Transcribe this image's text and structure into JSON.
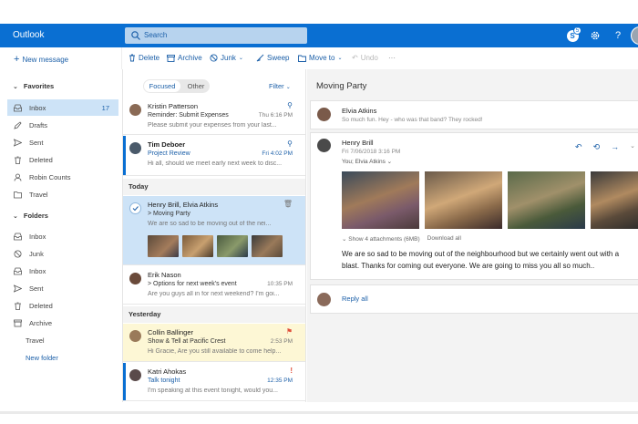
{
  "header": {
    "brand": "Outlook",
    "search_placeholder": "Search",
    "skype_badge": "5"
  },
  "toolbar": {
    "new_message": "New message",
    "delete": "Delete",
    "archive": "Archive",
    "junk": "Junk",
    "sweep": "Sweep",
    "move_to": "Move to",
    "undo": "Undo",
    "more": "···"
  },
  "nav": {
    "favorites_label": "Favorites",
    "favorites": [
      {
        "label": "Inbox",
        "count": "17"
      },
      {
        "label": "Drafts"
      },
      {
        "label": "Sent"
      },
      {
        "label": "Deleted"
      },
      {
        "label": "Robin Counts"
      },
      {
        "label": "Travel"
      }
    ],
    "folders_label": "Folders",
    "folders": [
      {
        "label": "Inbox"
      },
      {
        "label": "Junk"
      },
      {
        "label": "Inbox"
      },
      {
        "label": "Sent"
      },
      {
        "label": "Deleted"
      },
      {
        "label": "Archive"
      },
      {
        "label": "Travel"
      }
    ],
    "new_folder": "New folder"
  },
  "list": {
    "tab_focused": "Focused",
    "tab_other": "Other",
    "filter": "Filter",
    "section_today": "Today",
    "section_yesterday": "Yesterday",
    "messages": [
      {
        "from": "Kristin Patterson",
        "subject": "Reminder: Submit Expenses",
        "preview": "Please submit your expenses from your last...",
        "time": "Thu 6:16 PM"
      },
      {
        "from": "Tim Deboer",
        "subject": "Project Review",
        "preview": "Hi all, should we meet early next week to disc...",
        "time": "Fri 4:02 PM"
      },
      {
        "from": "Henry Brill, Elvia Atkins",
        "subject": "> Moving Party",
        "preview": "We are so sad to be moving out of the nei...",
        "time": ""
      },
      {
        "from": "Erik Nason",
        "subject": "> Options for next week's event",
        "preview": "Are you guys all in for next weekend? I'm goi...",
        "time": "10:35 PM"
      },
      {
        "from": "Collin Ballinger",
        "subject": "Show & Tell at Pacific Crest",
        "preview": "Hi Gracie, Are you still available to come help...",
        "time": "2:53 PM"
      },
      {
        "from": "Katri Ahokas",
        "subject": "Talk tonight",
        "preview": "I'm speaking at this event tonight, would you...",
        "time": "12:35 PM"
      }
    ]
  },
  "reading": {
    "title": "Moving Party",
    "first": {
      "from": "Elvia Atkins",
      "snippet": "So much fun. Hey - who was that band? They rocked!"
    },
    "second": {
      "from": "Henry Brill",
      "date": "Fri 7/06/2018 3:16 PM",
      "to": "You; Elvia Atkins",
      "show_attachments": "Show 4 attachments (6MB)",
      "download_all": "Download all",
      "body": "We are so sad to be moving out of the neighbourhood but we certainly went out with a blast. Thanks for coming out everyone. We are going to miss you all so much.."
    },
    "reply_all": "Reply all"
  },
  "colors": {
    "brand_blue": "#0a6fd2",
    "selected_bg": "#cde3f7",
    "flagged_bg": "#fdf7d5",
    "flag_red": "#e04f3b"
  }
}
